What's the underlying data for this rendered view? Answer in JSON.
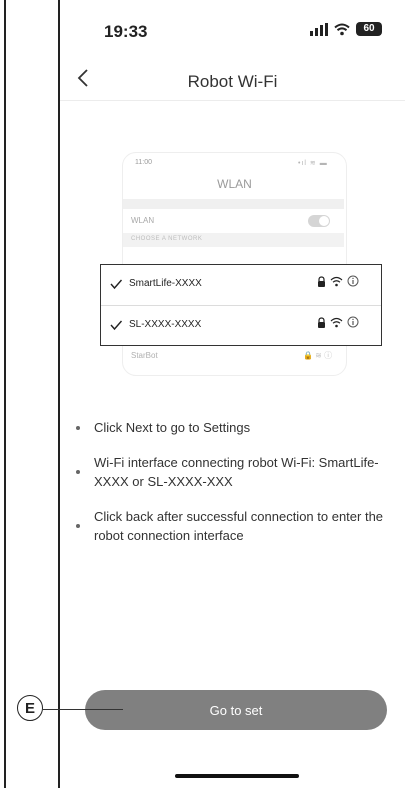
{
  "status_bar": {
    "time": "19:33",
    "battery": "60"
  },
  "nav": {
    "title": "Robot Wi-Fi"
  },
  "illustration": {
    "time": "11:00",
    "title": "WLAN",
    "wlan_label": "WLAN",
    "choose_label": "CHOOSE A NETWORK",
    "networks": [
      {
        "name": "SmartLife-XXXX",
        "checked": true
      },
      {
        "name": "SL-XXXX-XXXX",
        "checked": true
      }
    ],
    "extra_network": "StarBot"
  },
  "instructions": [
    "Click Next to go to Settings",
    "Wi-Fi interface connecting robot Wi-Fi: SmartLife-XXXX or SL-XXXX-XXX",
    "Click back after successful connection to enter the robot connection interface"
  ],
  "button": {
    "label": "Go to set"
  },
  "callout": {
    "label": "E"
  },
  "colors": {
    "button": "#808080",
    "text": "#333333",
    "frame": "#222222"
  }
}
